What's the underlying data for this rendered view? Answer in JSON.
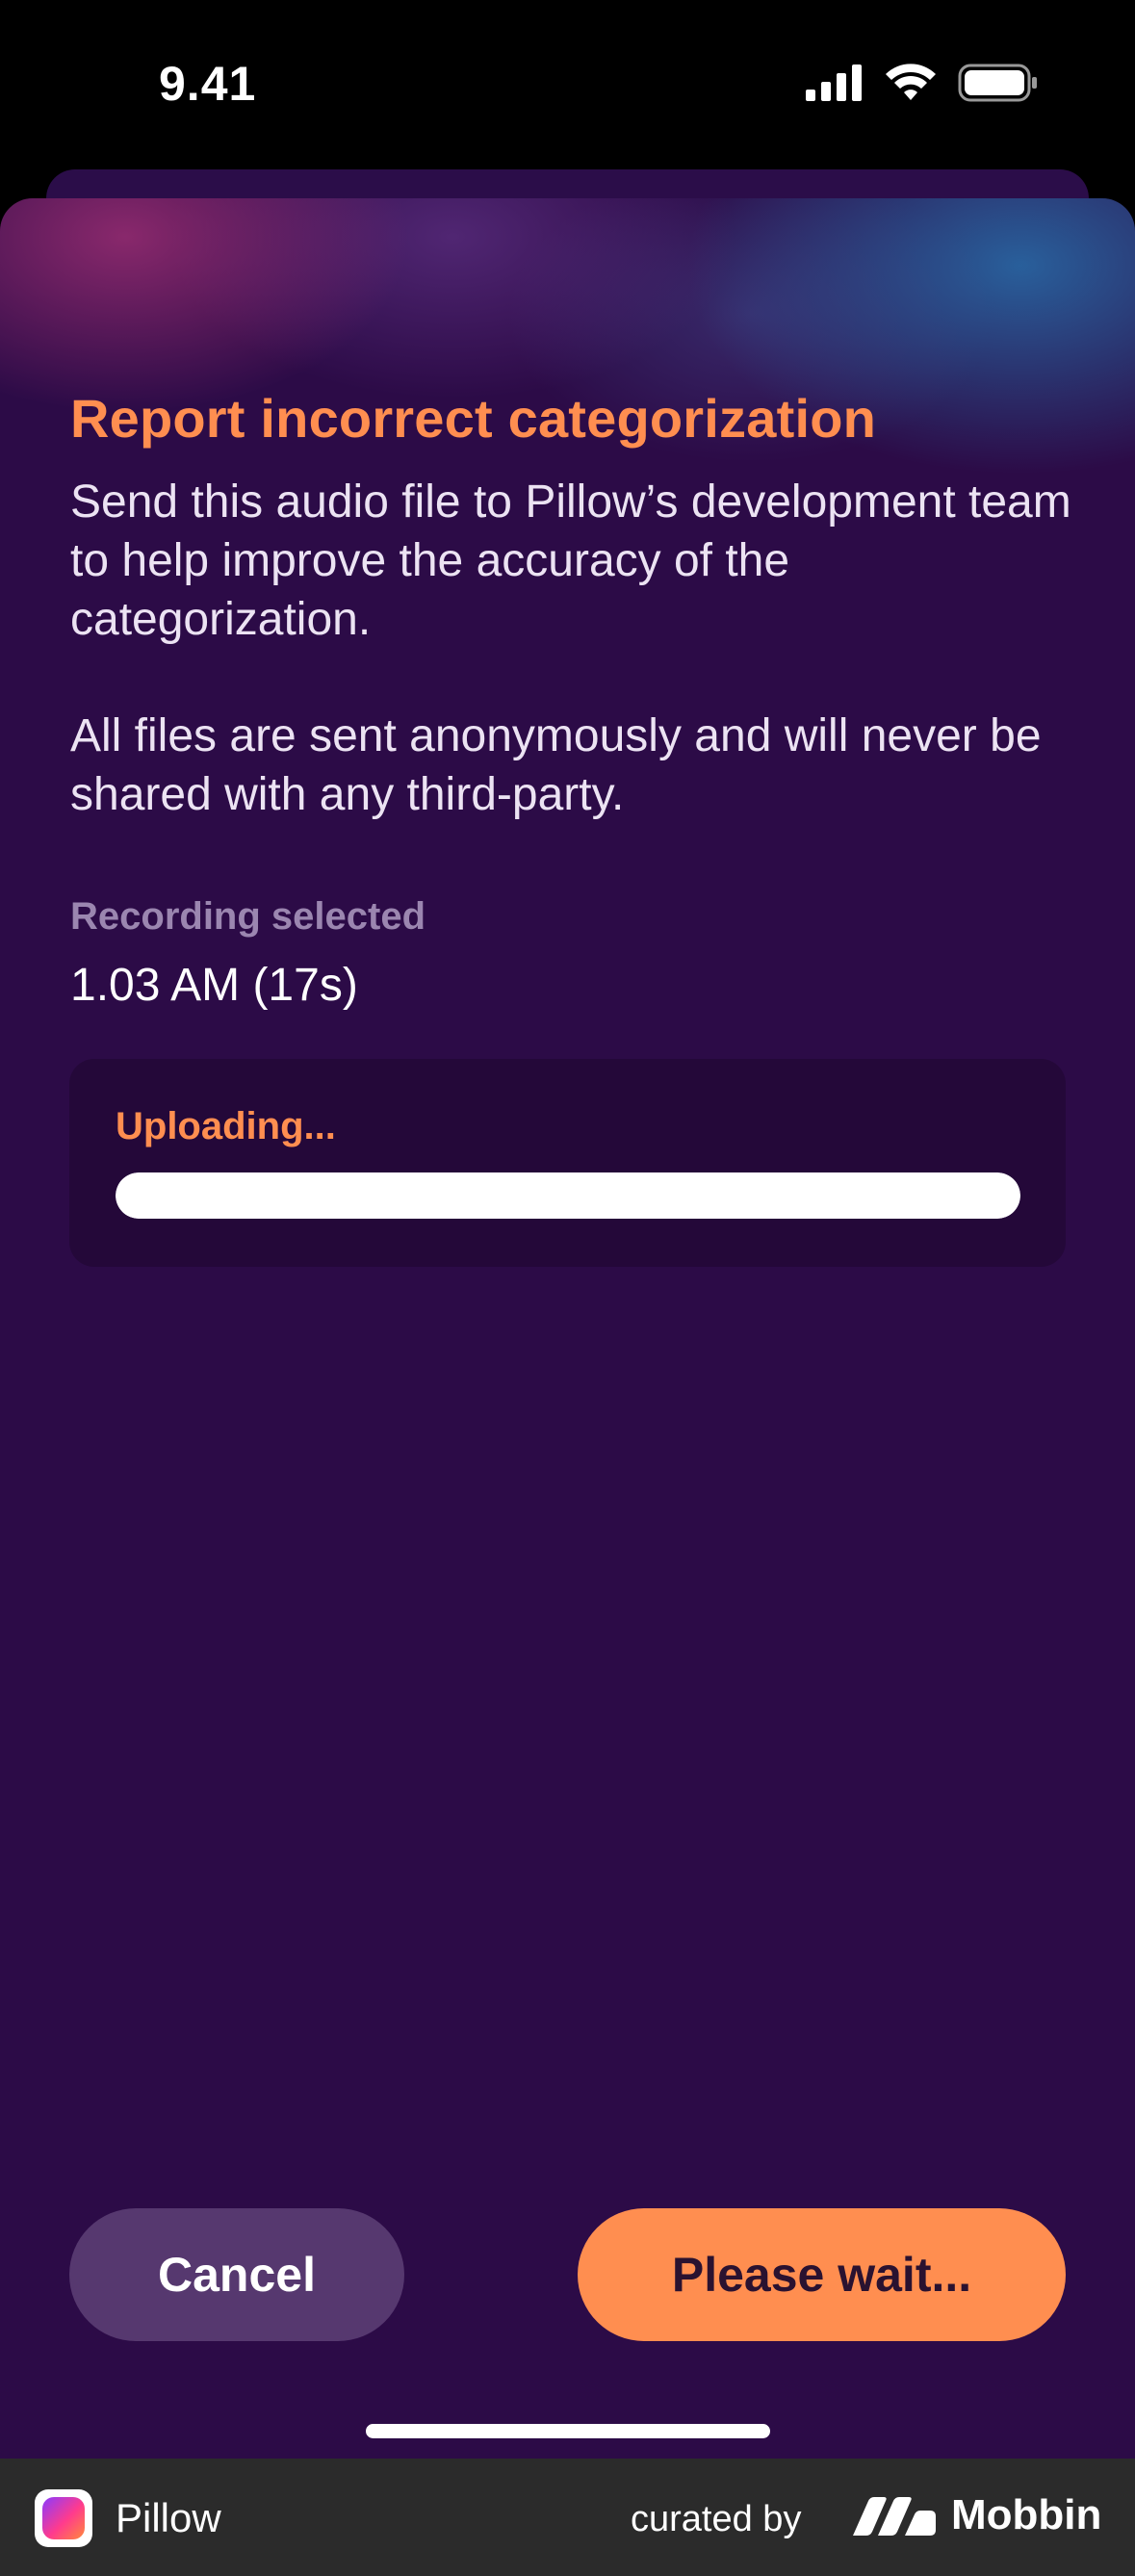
{
  "status_bar": {
    "time": "9.41"
  },
  "sheet": {
    "title": "Report incorrect categorization",
    "paragraph_1": "Send this audio file to Pillow’s development team to help improve the accuracy of the categorization.",
    "paragraph_2": "All files are sent anonymously and will never be shared with any third-party.",
    "recording_label": "Recording selected",
    "recording_value": "1.03 AM (17s)",
    "upload": {
      "label": "Uploading...",
      "progress_percent": 100
    }
  },
  "actions": {
    "cancel_label": "Cancel",
    "primary_label": "Please wait..."
  },
  "footer": {
    "app_name": "Pillow",
    "curated_by": "curated by",
    "brand": "Mobbin"
  },
  "colors": {
    "accent": "#ff8e50",
    "sheet_background": "#2c0b47",
    "cancel_button": "#56386f"
  },
  "icons": [
    "signal-icon",
    "wifi-icon",
    "battery-icon",
    "pillow-app-icon",
    "mobbin-logo-icon"
  ]
}
